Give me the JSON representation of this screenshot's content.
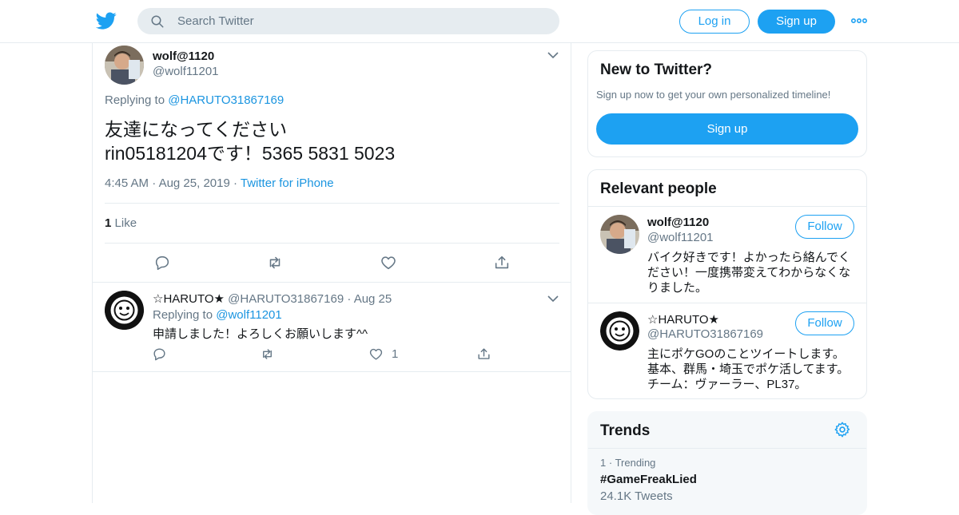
{
  "header": {
    "search_placeholder": "Search Twitter",
    "login_label": "Log in",
    "signup_label": "Sign up"
  },
  "tweet": {
    "author_name": "wolf@1120",
    "author_handle": "@wolf11201",
    "replying_prefix": "Replying to",
    "replying_to": "@HARUTO31867169",
    "text_line1": "友達になってください",
    "text_line2": "rin05181204です！5365 5831 5023",
    "time": "4:45 AM",
    "date": "Aug 25, 2019",
    "source": "Twitter for iPhone",
    "like_count": "1",
    "like_label": "Like"
  },
  "reply": {
    "author_name": "☆HARUTO★",
    "author_handle": "@HARUTO31867169",
    "date": "Aug 25",
    "replying_prefix": "Replying to",
    "replying_to": "@wolf11201",
    "text": "申請しました！よろしくお願いします^^",
    "like_count": "1"
  },
  "new_to_twitter": {
    "title": "New to Twitter?",
    "subtitle": "Sign up now to get your own personalized timeline!",
    "signup_label": "Sign up"
  },
  "relevant_people": {
    "title": "Relevant people",
    "follow_label": "Follow",
    "people": [
      {
        "name": "wolf@1120",
        "handle": "@wolf11201",
        "bio_lines": [
          "バイク好きです！よかったら絡んでく",
          "ださい！一度携帯変えてわからなくな",
          "りました。"
        ]
      },
      {
        "name": "☆HARUTO★",
        "handle": "@HARUTO31867169",
        "bio_lines": [
          "主にポケGOのことツイートします。",
          "基本、群馬・埼玉でポケ活してます。",
          "チーム：ヴァーラー、PL37。"
        ]
      }
    ]
  },
  "trends": {
    "title": "Trends",
    "items": [
      {
        "rank": "1",
        "context": "Trending",
        "name": "#GameFreakLied",
        "count": "24.1K Tweets"
      }
    ]
  },
  "colors": {
    "accent": "#1da1f2",
    "link": "#1b95e0",
    "secondary_text": "#657786",
    "border": "#e6ecf0",
    "trends_bg": "#f5f8fa"
  }
}
